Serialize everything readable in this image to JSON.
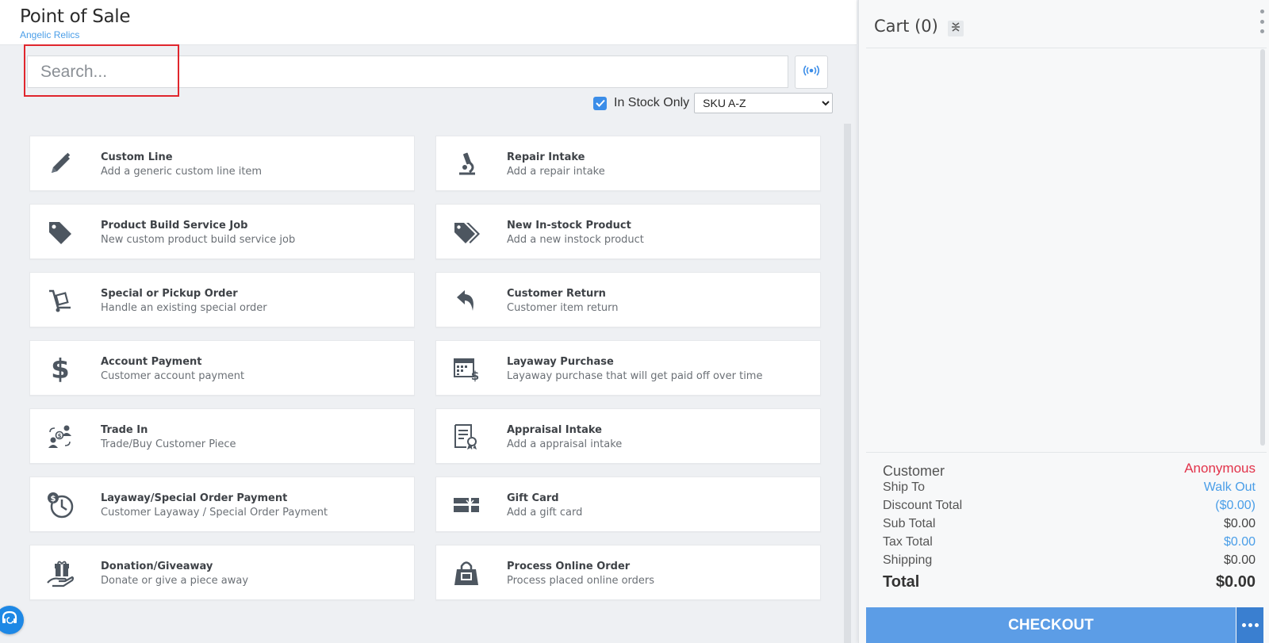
{
  "header": {
    "title": "Point of Sale",
    "store": "Angelic Relics"
  },
  "search": {
    "placeholder": "Search..."
  },
  "filters": {
    "in_stock_only_label": "In Stock Only",
    "in_stock_only_checked": true,
    "sort_selected": "SKU A-Z",
    "sort_options": [
      "SKU A-Z"
    ]
  },
  "tiles": [
    {
      "title": "Custom Line",
      "subtitle": "Add a generic custom line item",
      "icon": "pencil-icon"
    },
    {
      "title": "Repair Intake",
      "subtitle": "Add a repair intake",
      "icon": "microscope-icon"
    },
    {
      "title": "Product Build Service Job",
      "subtitle": "New custom product build service job",
      "icon": "tag-icon"
    },
    {
      "title": "New In-stock Product",
      "subtitle": "Add a new instock product",
      "icon": "tags-icon"
    },
    {
      "title": "Special or Pickup Order",
      "subtitle": "Handle an existing special order",
      "icon": "dolly-icon"
    },
    {
      "title": "Customer Return",
      "subtitle": "Customer item return",
      "icon": "reply-arrow-icon"
    },
    {
      "title": "Account Payment",
      "subtitle": "Customer account payment",
      "icon": "dollar-icon"
    },
    {
      "title": "Layaway Purchase",
      "subtitle": "Layaway purchase that will get paid off over time",
      "icon": "calendar-dollar-icon"
    },
    {
      "title": "Trade In",
      "subtitle": "Trade/Buy Customer Piece",
      "icon": "trade-exchange-icon"
    },
    {
      "title": "Appraisal Intake",
      "subtitle": "Add a appraisal intake",
      "icon": "certificate-icon"
    },
    {
      "title": "Layaway/Special Order Payment",
      "subtitle": "Customer Layaway / Special Order Payment",
      "icon": "clock-dollar-icon"
    },
    {
      "title": "Gift Card",
      "subtitle": "Add a gift card",
      "icon": "gift-card-icon"
    },
    {
      "title": "Donation/Giveaway",
      "subtitle": "Donate or give a piece away",
      "icon": "hand-gift-icon"
    },
    {
      "title": "Process Online Order",
      "subtitle": "Process placed online orders",
      "icon": "shopping-bag-icon"
    }
  ],
  "cart": {
    "title": "Cart (0)",
    "customer_label": "Customer",
    "customer_value": "Anonymous",
    "ship_to_label": "Ship To",
    "ship_to_value": "Walk Out",
    "discount_label": "Discount Total",
    "discount_value": "($0.00)",
    "subtotal_label": "Sub Total",
    "subtotal_value": "$0.00",
    "tax_label": "Tax Total",
    "tax_value": "$0.00",
    "shipping_label": "Shipping",
    "shipping_value": "$0.00",
    "total_label": "Total",
    "total_value": "$0.00",
    "checkout_label": "CHECKOUT"
  },
  "colors": {
    "accent": "#4a9ee8",
    "checkout": "#5c9de6",
    "alert": "#e2334a",
    "icon": "#4d5660"
  }
}
